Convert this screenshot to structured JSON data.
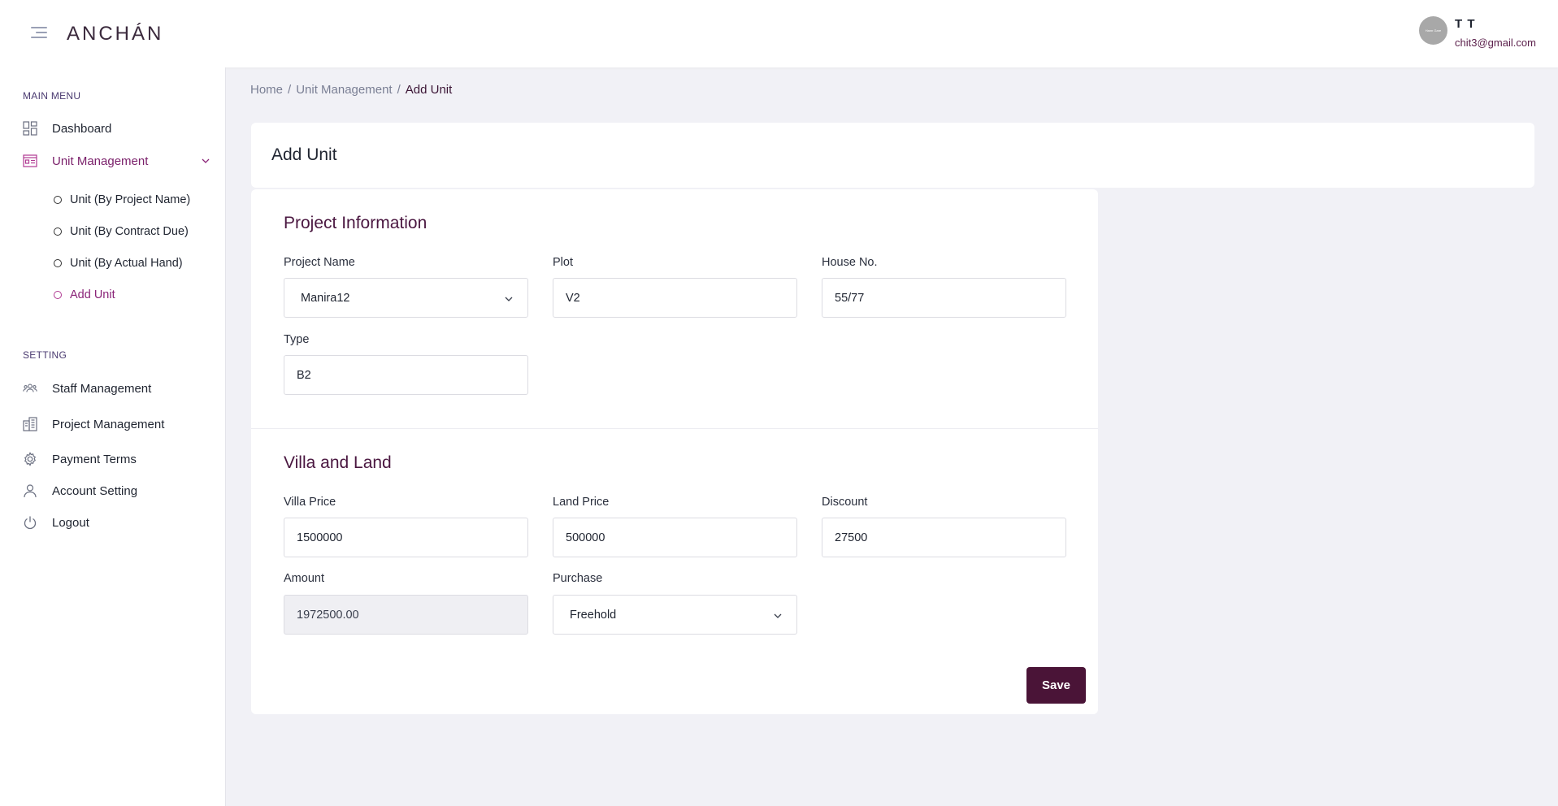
{
  "header": {
    "logo": "ANCHÁN",
    "avatar_text": "Hann Gare",
    "user_name": "T T",
    "user_email": "chit3@gmail.com"
  },
  "sidebar": {
    "main_menu_label": "MAIN MENU",
    "setting_label": "SETTING",
    "items": {
      "dashboard": "Dashboard",
      "unit_management": "Unit Management",
      "staff_management": "Staff Management",
      "project_management": "Project Management",
      "payment_terms": "Payment Terms",
      "account_setting": "Account Setting",
      "logout": "Logout"
    },
    "sub_items": {
      "by_project_name": "Unit (By Project Name)",
      "by_contract_due": "Unit (By Contract Due)",
      "by_actual_hand": "Unit (By Actual Hand)",
      "add_unit": "Add Unit"
    },
    "active_color": "#7a1f6a"
  },
  "breadcrumb": {
    "home": "Home",
    "unit_management": "Unit Management",
    "current": "Add Unit",
    "separator": "/"
  },
  "page": {
    "title": "Add Unit"
  },
  "form": {
    "project_info": {
      "title": "Project Information",
      "project_name_label": "Project Name",
      "project_name_value": "Manira12",
      "plot_label": "Plot",
      "plot_value": "V2",
      "house_no_label": "House No.",
      "house_no_value": "55/77",
      "type_label": "Type",
      "type_value": "B2"
    },
    "villa_land": {
      "title": "Villa and Land",
      "villa_price_label": "Villa Price",
      "villa_price_value": "1500000",
      "land_price_label": "Land Price",
      "land_price_value": "500000",
      "discount_label": "Discount",
      "discount_value": "27500",
      "amount_label": "Amount",
      "amount_value": "1972500.00",
      "purchase_label": "Purchase",
      "purchase_value": "Freehold"
    },
    "save_label": "Save",
    "save_color": "#4a1437"
  }
}
